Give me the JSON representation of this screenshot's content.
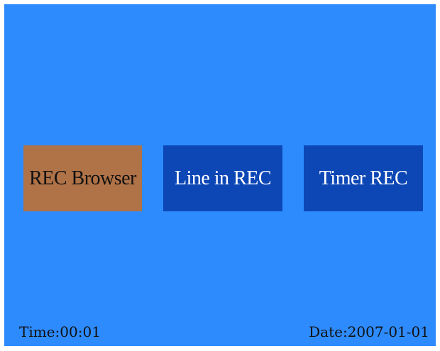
{
  "menu": {
    "items": [
      {
        "label": "REC Browser",
        "selected": true
      },
      {
        "label": "Line in REC",
        "selected": false
      },
      {
        "label": "Timer REC",
        "selected": false
      }
    ]
  },
  "status": {
    "time": "Time:00:01",
    "date": "Date:2007-01-01"
  },
  "colors": {
    "background": "#2e8bfd",
    "item_normal": "#0d47b6",
    "item_selected": "#b07247"
  }
}
